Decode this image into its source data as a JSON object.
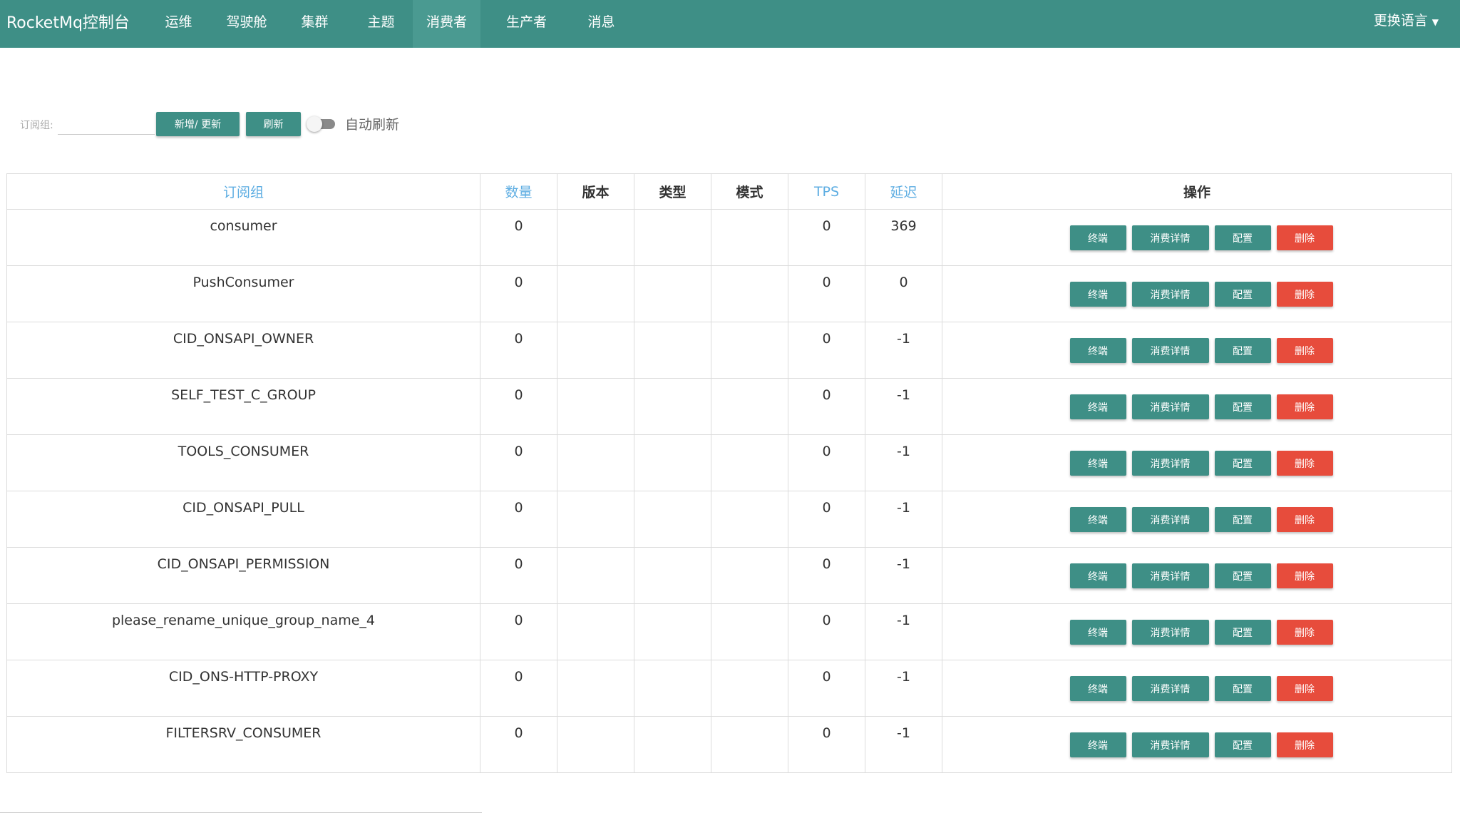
{
  "nav": {
    "brand": "RocketMq控制台",
    "items": [
      {
        "label": "运维",
        "active": false
      },
      {
        "label": "驾驶舱",
        "active": false
      },
      {
        "label": "集群",
        "active": false
      },
      {
        "label": "主题",
        "active": false
      },
      {
        "label": "消费者",
        "active": true
      },
      {
        "label": "生产者",
        "active": false
      },
      {
        "label": "消息",
        "active": false
      }
    ],
    "language": "更换语言"
  },
  "toolbar": {
    "label": "订阅组:",
    "input_value": "",
    "add_update": "新增/ 更新",
    "refresh": "刷新",
    "auto_refresh": "自动刷新",
    "auto_refresh_on": false
  },
  "table": {
    "headers": [
      "订阅组",
      "数量",
      "版本",
      "类型",
      "模式",
      "TPS",
      "延迟",
      "操作"
    ],
    "actions": {
      "terminal": "终端",
      "detail": "消费详情",
      "config": "配置",
      "delete": "删除"
    },
    "rows": [
      {
        "group": "consumer",
        "count": "0",
        "version": "",
        "type": "",
        "mode": "",
        "tps": "0",
        "delay": "369"
      },
      {
        "group": "PushConsumer",
        "count": "0",
        "version": "",
        "type": "",
        "mode": "",
        "tps": "0",
        "delay": "0"
      },
      {
        "group": "CID_ONSAPI_OWNER",
        "count": "0",
        "version": "",
        "type": "",
        "mode": "",
        "tps": "0",
        "delay": "-1"
      },
      {
        "group": "SELF_TEST_C_GROUP",
        "count": "0",
        "version": "",
        "type": "",
        "mode": "",
        "tps": "0",
        "delay": "-1"
      },
      {
        "group": "TOOLS_CONSUMER",
        "count": "0",
        "version": "",
        "type": "",
        "mode": "",
        "tps": "0",
        "delay": "-1"
      },
      {
        "group": "CID_ONSAPI_PULL",
        "count": "0",
        "version": "",
        "type": "",
        "mode": "",
        "tps": "0",
        "delay": "-1"
      },
      {
        "group": "CID_ONSAPI_PERMISSION",
        "count": "0",
        "version": "",
        "type": "",
        "mode": "",
        "tps": "0",
        "delay": "-1"
      },
      {
        "group": "please_rename_unique_group_name_4",
        "count": "0",
        "version": "",
        "type": "",
        "mode": "",
        "tps": "0",
        "delay": "-1"
      },
      {
        "group": "CID_ONS-HTTP-PROXY",
        "count": "0",
        "version": "",
        "type": "",
        "mode": "",
        "tps": "0",
        "delay": "-1"
      },
      {
        "group": "FILTERSRV_CONSUMER",
        "count": "0",
        "version": "",
        "type": "",
        "mode": "",
        "tps": "0",
        "delay": "-1"
      }
    ]
  },
  "colors": {
    "primary": "#3e8f86",
    "danger": "#e74c3c",
    "sort_header": "#5dade2"
  }
}
